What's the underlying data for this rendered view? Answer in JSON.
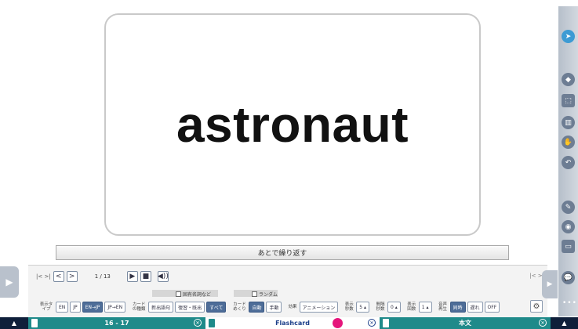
{
  "card": {
    "word": "astronaut"
  },
  "repeat_bar": {
    "label": "あとで繰り返す"
  },
  "nav": {
    "first_last": "|< >|",
    "prev": "<",
    "next": ">",
    "counter": "1 / 13",
    "play": "▶",
    "stop": "■",
    "audio": "◀))",
    "right_nav": "|< >|"
  },
  "checkboxes": {
    "proper_nouns": "固有名詞など",
    "random": "ランダム"
  },
  "options": {
    "display_type_label": "表示タイプ",
    "display_types": [
      "EN",
      "JP",
      "EN→JP",
      "JP→EN"
    ],
    "display_type_selected": "EN→JP",
    "card_kind_label": "カードの種類",
    "card_kinds": [
      "新出語句",
      "復習・既出",
      "すべて"
    ],
    "card_kind_selected": "すべて",
    "card_flip_label": "カードめくり",
    "card_flips": [
      "自動",
      "手動"
    ],
    "card_flip_selected": "自動",
    "effect_label": "効果",
    "effect_value": "アニメーション",
    "display_sec_label": "表示秒数",
    "display_sec_value": "5",
    "interval_sec_label": "間隔秒数",
    "interval_sec_value": "0",
    "display_count_label": "表示回数",
    "display_count_value": "1",
    "audio_label": "音声再生",
    "audio_options": [
      "同時",
      "遅れ",
      "OFF"
    ],
    "audio_selected": "同時"
  },
  "taskbar": {
    "pages": "16 - 17",
    "center": "Flashcard",
    "right": "本文"
  },
  "colors": {
    "taskbar_bg": "#0f1f3a",
    "teal": "#1f8a8a",
    "accent": "#3d9bd4",
    "record": "#e5157b"
  }
}
